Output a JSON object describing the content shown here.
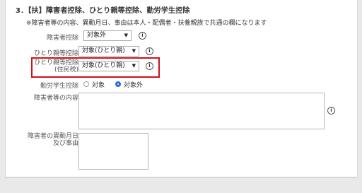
{
  "section": {
    "heading": "3．【扶】障害者控除、ひとり親等控除、勤労学生控除",
    "note": "※障害者等の内容、異動月日、事由は本人・配偶者・扶養親族で共通の欄になります"
  },
  "fields": {
    "disability": {
      "label": "障害者控除",
      "value": "対象外"
    },
    "single_parent": {
      "label": "ひとり親等控除",
      "value": "対象(ひとり親)"
    },
    "single_parent_resident": {
      "label_line1": "ひとり親等控除",
      "label_line2": "(住民税)",
      "value": "対象(ひとり親)"
    },
    "working_student": {
      "label": "勤労学生控除",
      "option_yes": "対象",
      "option_no": "対象外",
      "selected": "対象外"
    },
    "disability_details": {
      "label": "障害者等の内容"
    },
    "change_date_reason": {
      "label_line1": "障害者の異動月日",
      "label_line2": "及び事由"
    }
  },
  "icons": {
    "info": "i",
    "dropdown": "▼"
  },
  "colors": {
    "highlight": "#d0101c",
    "radio_selected": "#2a6ad8"
  }
}
